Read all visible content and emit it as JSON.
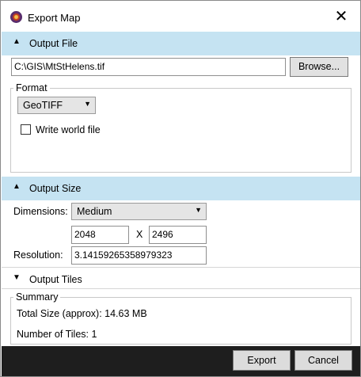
{
  "window": {
    "title": "Export Map",
    "close": "✕"
  },
  "output_file": {
    "header": "Output File",
    "path": "C:\\GIS\\MtStHelens.tif",
    "browse_label": "Browse..."
  },
  "format": {
    "legend": "Format",
    "selected": "GeoTIFF",
    "world_file_label": "Write world file",
    "world_file_checked": false
  },
  "output_size": {
    "header": "Output Size",
    "dimensions_label": "Dimensions:",
    "dimensions_value": "Medium",
    "width": "2048",
    "x_sep": "X",
    "height": "2496",
    "resolution_label": "Resolution:",
    "resolution_value": "3.14159265358979323"
  },
  "output_tiles": {
    "header": "Output Tiles"
  },
  "summary": {
    "legend": "Summary",
    "total_size": "Total Size (approx): 14.63 MB",
    "tiles": "Number of Tiles: 1"
  },
  "footer": {
    "export_label": "Export",
    "cancel_label": "Cancel"
  }
}
